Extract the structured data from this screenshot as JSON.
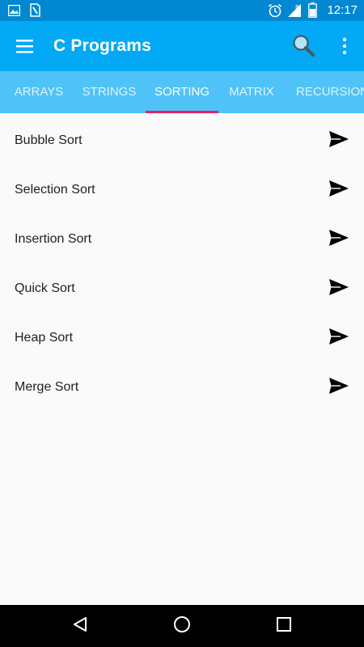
{
  "status_bar": {
    "time": "12:17",
    "left_icons": [
      "image-notification-icon",
      "sim-notification-icon"
    ],
    "right_icons": [
      "alarm-icon",
      "signal-icon",
      "battery-icon"
    ]
  },
  "app_bar": {
    "title": "C Programs",
    "icons": [
      "menu-icon",
      "search-icon",
      "more-vert-icon"
    ],
    "color": "#03a9f4"
  },
  "tabs": [
    {
      "label": "ARRAYS",
      "active": false
    },
    {
      "label": "STRINGS",
      "active": false
    },
    {
      "label": "SORTING",
      "active": true
    },
    {
      "label": "MATRIX",
      "active": false
    },
    {
      "label": "RECURSION",
      "active": false
    }
  ],
  "tab_colors": {
    "background": "#4fc3f7",
    "indicator": "#e91e63"
  },
  "programs": [
    {
      "label": "Bubble Sort",
      "icon": "send-icon"
    },
    {
      "label": "Selection Sort",
      "icon": "send-icon"
    },
    {
      "label": "Insertion Sort",
      "icon": "send-icon"
    },
    {
      "label": "Quick Sort",
      "icon": "send-icon"
    },
    {
      "label": "Heap Sort",
      "icon": "send-icon"
    },
    {
      "label": "Merge Sort",
      "icon": "send-icon"
    }
  ],
  "nav_bar": {
    "icons": [
      "back-icon",
      "home-icon",
      "recents-icon"
    ]
  }
}
